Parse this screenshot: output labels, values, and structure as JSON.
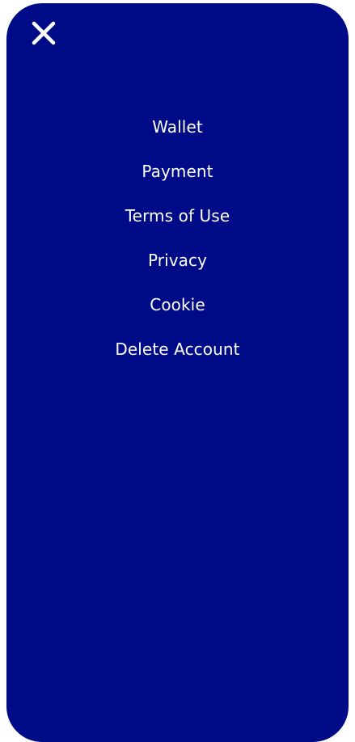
{
  "colors": {
    "background": "#000b87",
    "text": "#ffffff"
  },
  "close_button": {
    "icon": "close-icon"
  },
  "menu": {
    "items": [
      {
        "label": "Wallet"
      },
      {
        "label": "Payment"
      },
      {
        "label": "Terms of Use"
      },
      {
        "label": "Privacy"
      },
      {
        "label": "Cookie"
      },
      {
        "label": "Delete Account"
      }
    ]
  }
}
